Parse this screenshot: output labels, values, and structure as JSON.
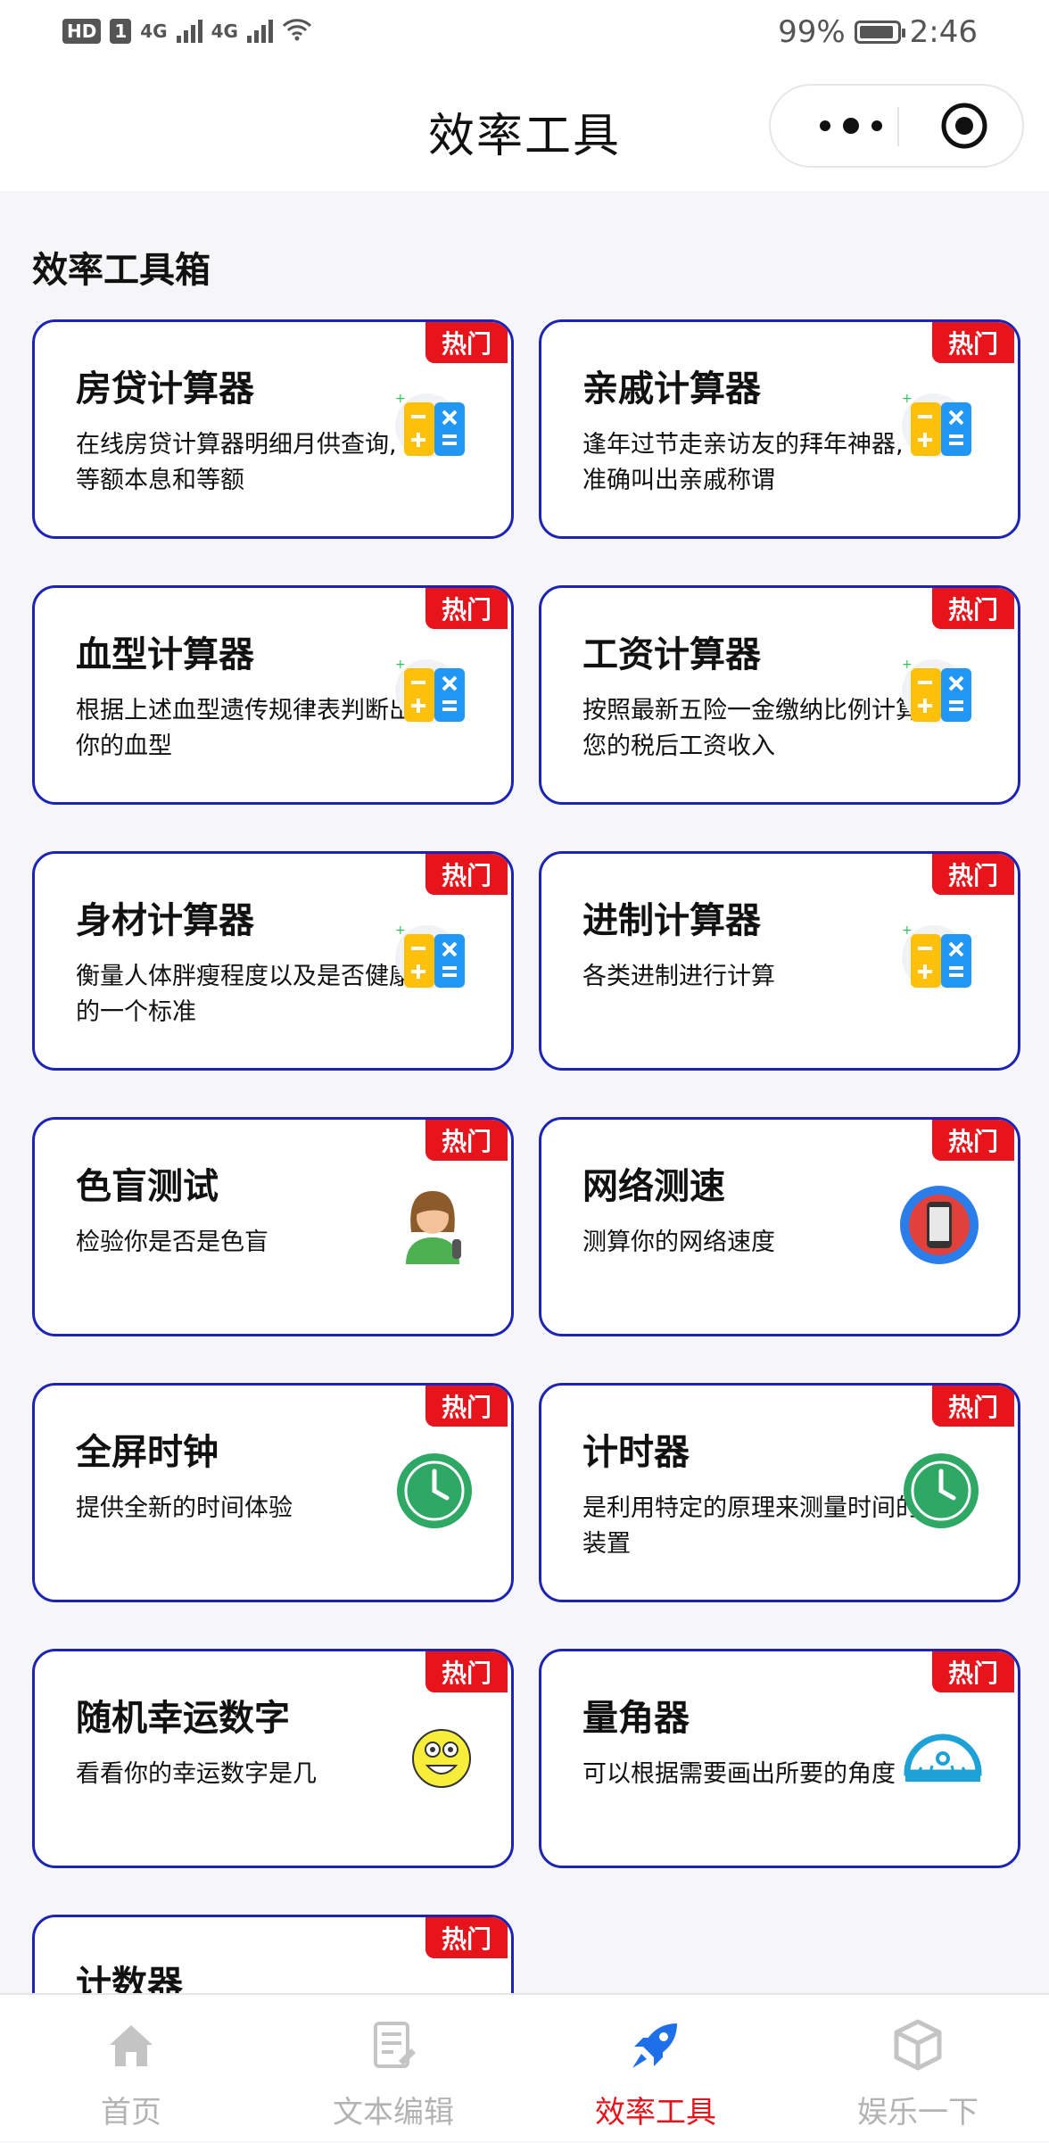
{
  "status_bar": {
    "hd": "HD",
    "sim": "1",
    "network1": "4G",
    "network2": "4G",
    "battery": "99%",
    "time": "2:46"
  },
  "nav": {
    "title": "效率工具"
  },
  "section": {
    "title": "效率工具箱"
  },
  "badge_label": "热门",
  "cards": [
    {
      "title": "房贷计算器",
      "desc": "在线房贷计算器明细月供查询,等额本息和等额",
      "icon": "calculator-icon"
    },
    {
      "title": "亲戚计算器",
      "desc": "逢年过节走亲访友的拜年神器,准确叫出亲戚称谓",
      "icon": "calculator-icon"
    },
    {
      "title": "血型计算器",
      "desc": "根据上述血型遗传规律表判断出你的血型",
      "icon": "calculator-icon"
    },
    {
      "title": "工资计算器",
      "desc": "按照最新五险一金缴纳比例计算您的税后工资收入",
      "icon": "calculator-icon"
    },
    {
      "title": "身材计算器",
      "desc": "衡量人体胖瘦程度以及是否健康的一个标准",
      "icon": "calculator-icon"
    },
    {
      "title": "进制计算器",
      "desc": "各类进制进行计算",
      "icon": "calculator-icon"
    },
    {
      "title": "色盲测试",
      "desc": "检验你是否是色盲",
      "icon": "person-icon"
    },
    {
      "title": "网络测速",
      "desc": "测算你的网络速度",
      "icon": "phone-icon"
    },
    {
      "title": "全屏时钟",
      "desc": "提供全新的时间体验",
      "icon": "clock-icon"
    },
    {
      "title": "计时器",
      "desc": "是利用特定的原理来测量时间的装置",
      "icon": "clock-icon"
    },
    {
      "title": "随机幸运数字",
      "desc": "看看你的幸运数字是几",
      "icon": "smiley-icon"
    },
    {
      "title": "量角器",
      "desc": "可以根据需要画出所要的角度",
      "icon": "protractor-icon"
    },
    {
      "title": "计数器",
      "desc": "",
      "icon": "counter-icon"
    }
  ],
  "tabs": [
    {
      "label": "首页",
      "icon": "home-icon"
    },
    {
      "label": "文本编辑",
      "icon": "document-edit-icon"
    },
    {
      "label": "效率工具",
      "icon": "rocket-icon",
      "active": true
    },
    {
      "label": "娱乐一下",
      "icon": "cube-icon"
    }
  ],
  "colors": {
    "accent": "#e8141c",
    "card_border": "#1c23b5",
    "tab_inactive": "#b3b3b3"
  }
}
